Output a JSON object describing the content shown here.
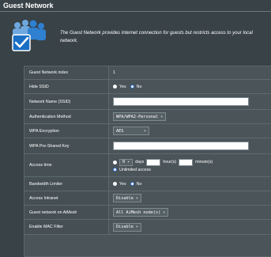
{
  "page": {
    "title": "Guest Network",
    "description": "The Guest Network provides Internet connection for guests but restricts access to your local network."
  },
  "form": {
    "guest_network_index": {
      "label": "Guest Network index",
      "value": "1"
    },
    "hide_ssid": {
      "label": "Hide SSID",
      "options": [
        "Yes",
        "No"
      ],
      "selected": "No"
    },
    "network_name": {
      "label": "Network Name (SSID)",
      "value": ""
    },
    "auth_method": {
      "label": "Authentication Method",
      "value": "WPA/WPA2-Personal"
    },
    "wpa_encryption": {
      "label": "WPA Encryption",
      "value": "AES"
    },
    "wpa_key": {
      "label": "WPA Pre-Shared Key",
      "value": ""
    },
    "access_time": {
      "label": "Access time",
      "days_value": "0",
      "days_unit": "days",
      "hours_unit": "hour(s)",
      "minutes_unit": "minute(s)",
      "unlimited_label": "Unlimited access",
      "selected": "Unlimited access"
    },
    "bandwidth_limiter": {
      "label": "Bandwidth Limiter",
      "options": [
        "Yes",
        "No"
      ],
      "selected": "No"
    },
    "access_intranet": {
      "label": "Access Intranet",
      "value": "Disable"
    },
    "aimesh": {
      "label": "Guest network on AiMesh",
      "value": "All AiMesh node(s)"
    },
    "mac_filter": {
      "label": "Enable MAC Filter",
      "value": "Disable"
    }
  },
  "colors": {
    "background": "#384247",
    "panel": "#4a5459",
    "radio_selected": "#2f6fd4",
    "logo_blue": "#1a6fc4"
  },
  "icons": {
    "logo": "guest-users-checkmark-icon",
    "dropdown": "chevron-down-icon"
  }
}
